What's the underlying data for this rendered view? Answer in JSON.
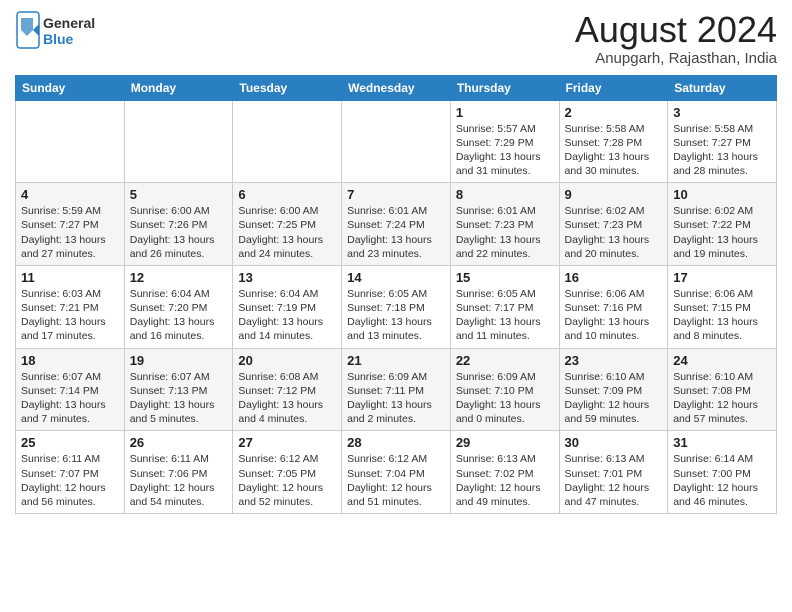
{
  "header": {
    "logo_general": "General",
    "logo_blue": "Blue",
    "month_title": "August 2024",
    "subtitle": "Anupgarh, Rajasthan, India"
  },
  "days_of_week": [
    "Sunday",
    "Monday",
    "Tuesday",
    "Wednesday",
    "Thursday",
    "Friday",
    "Saturday"
  ],
  "weeks": [
    [
      {
        "num": "",
        "info": ""
      },
      {
        "num": "",
        "info": ""
      },
      {
        "num": "",
        "info": ""
      },
      {
        "num": "",
        "info": ""
      },
      {
        "num": "1",
        "info": "Sunrise: 5:57 AM\nSunset: 7:29 PM\nDaylight: 13 hours\nand 31 minutes."
      },
      {
        "num": "2",
        "info": "Sunrise: 5:58 AM\nSunset: 7:28 PM\nDaylight: 13 hours\nand 30 minutes."
      },
      {
        "num": "3",
        "info": "Sunrise: 5:58 AM\nSunset: 7:27 PM\nDaylight: 13 hours\nand 28 minutes."
      }
    ],
    [
      {
        "num": "4",
        "info": "Sunrise: 5:59 AM\nSunset: 7:27 PM\nDaylight: 13 hours\nand 27 minutes."
      },
      {
        "num": "5",
        "info": "Sunrise: 6:00 AM\nSunset: 7:26 PM\nDaylight: 13 hours\nand 26 minutes."
      },
      {
        "num": "6",
        "info": "Sunrise: 6:00 AM\nSunset: 7:25 PM\nDaylight: 13 hours\nand 24 minutes."
      },
      {
        "num": "7",
        "info": "Sunrise: 6:01 AM\nSunset: 7:24 PM\nDaylight: 13 hours\nand 23 minutes."
      },
      {
        "num": "8",
        "info": "Sunrise: 6:01 AM\nSunset: 7:23 PM\nDaylight: 13 hours\nand 22 minutes."
      },
      {
        "num": "9",
        "info": "Sunrise: 6:02 AM\nSunset: 7:23 PM\nDaylight: 13 hours\nand 20 minutes."
      },
      {
        "num": "10",
        "info": "Sunrise: 6:02 AM\nSunset: 7:22 PM\nDaylight: 13 hours\nand 19 minutes."
      }
    ],
    [
      {
        "num": "11",
        "info": "Sunrise: 6:03 AM\nSunset: 7:21 PM\nDaylight: 13 hours\nand 17 minutes."
      },
      {
        "num": "12",
        "info": "Sunrise: 6:04 AM\nSunset: 7:20 PM\nDaylight: 13 hours\nand 16 minutes."
      },
      {
        "num": "13",
        "info": "Sunrise: 6:04 AM\nSunset: 7:19 PM\nDaylight: 13 hours\nand 14 minutes."
      },
      {
        "num": "14",
        "info": "Sunrise: 6:05 AM\nSunset: 7:18 PM\nDaylight: 13 hours\nand 13 minutes."
      },
      {
        "num": "15",
        "info": "Sunrise: 6:05 AM\nSunset: 7:17 PM\nDaylight: 13 hours\nand 11 minutes."
      },
      {
        "num": "16",
        "info": "Sunrise: 6:06 AM\nSunset: 7:16 PM\nDaylight: 13 hours\nand 10 minutes."
      },
      {
        "num": "17",
        "info": "Sunrise: 6:06 AM\nSunset: 7:15 PM\nDaylight: 13 hours\nand 8 minutes."
      }
    ],
    [
      {
        "num": "18",
        "info": "Sunrise: 6:07 AM\nSunset: 7:14 PM\nDaylight: 13 hours\nand 7 minutes."
      },
      {
        "num": "19",
        "info": "Sunrise: 6:07 AM\nSunset: 7:13 PM\nDaylight: 13 hours\nand 5 minutes."
      },
      {
        "num": "20",
        "info": "Sunrise: 6:08 AM\nSunset: 7:12 PM\nDaylight: 13 hours\nand 4 minutes."
      },
      {
        "num": "21",
        "info": "Sunrise: 6:09 AM\nSunset: 7:11 PM\nDaylight: 13 hours\nand 2 minutes."
      },
      {
        "num": "22",
        "info": "Sunrise: 6:09 AM\nSunset: 7:10 PM\nDaylight: 13 hours\nand 0 minutes."
      },
      {
        "num": "23",
        "info": "Sunrise: 6:10 AM\nSunset: 7:09 PM\nDaylight: 12 hours\nand 59 minutes."
      },
      {
        "num": "24",
        "info": "Sunrise: 6:10 AM\nSunset: 7:08 PM\nDaylight: 12 hours\nand 57 minutes."
      }
    ],
    [
      {
        "num": "25",
        "info": "Sunrise: 6:11 AM\nSunset: 7:07 PM\nDaylight: 12 hours\nand 56 minutes."
      },
      {
        "num": "26",
        "info": "Sunrise: 6:11 AM\nSunset: 7:06 PM\nDaylight: 12 hours\nand 54 minutes."
      },
      {
        "num": "27",
        "info": "Sunrise: 6:12 AM\nSunset: 7:05 PM\nDaylight: 12 hours\nand 52 minutes."
      },
      {
        "num": "28",
        "info": "Sunrise: 6:12 AM\nSunset: 7:04 PM\nDaylight: 12 hours\nand 51 minutes."
      },
      {
        "num": "29",
        "info": "Sunrise: 6:13 AM\nSunset: 7:02 PM\nDaylight: 12 hours\nand 49 minutes."
      },
      {
        "num": "30",
        "info": "Sunrise: 6:13 AM\nSunset: 7:01 PM\nDaylight: 12 hours\nand 47 minutes."
      },
      {
        "num": "31",
        "info": "Sunrise: 6:14 AM\nSunset: 7:00 PM\nDaylight: 12 hours\nand 46 minutes."
      }
    ]
  ]
}
